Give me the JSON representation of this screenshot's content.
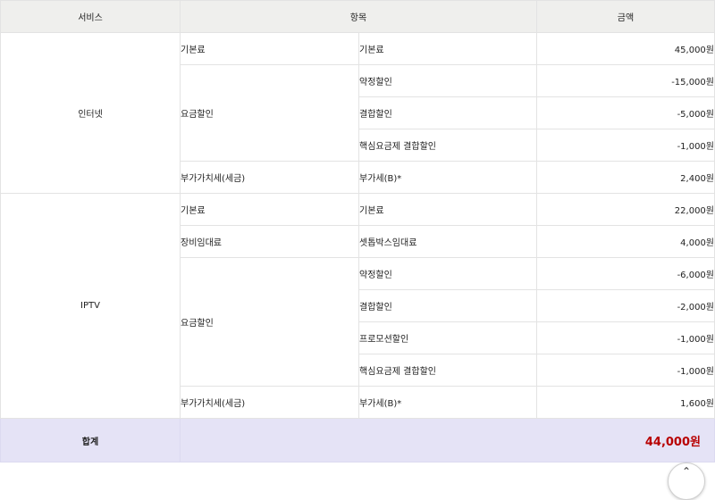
{
  "headers": {
    "service": "서비스",
    "item": "항목",
    "amount": "금액"
  },
  "internet": {
    "name": "인터넷",
    "basic": {
      "category": "기본료",
      "item": "기본료",
      "amount": "45,000원"
    },
    "discount": {
      "category": "요금할인",
      "rows": [
        {
          "item": "약정할인",
          "amount": "-15,000원"
        },
        {
          "item": "결합할인",
          "amount": "-5,000원"
        },
        {
          "item": "핵심요금제 결합할인",
          "amount": "-1,000원"
        }
      ]
    },
    "tax": {
      "category": "부가가치세(세금)",
      "item": "부가세(B)*",
      "amount": "2,400원"
    }
  },
  "iptv": {
    "name": "IPTV",
    "basic": {
      "category": "기본료",
      "item": "기본료",
      "amount": "22,000원"
    },
    "rental": {
      "category": "장비임대료",
      "item": "셋톱박스임대료",
      "amount": "4,000원"
    },
    "discount": {
      "category": "요금할인",
      "rows": [
        {
          "item": "약정할인",
          "amount": "-6,000원"
        },
        {
          "item": "결합할인",
          "amount": "-2,000원"
        },
        {
          "item": "프로모션할인",
          "amount": "-1,000원"
        },
        {
          "item": "핵심요금제 결합할인",
          "amount": "-1,000원"
        }
      ]
    },
    "tax": {
      "category": "부가가치세(세금)",
      "item": "부가세(B)*",
      "amount": "1,600원"
    }
  },
  "total": {
    "label": "합계",
    "amount": "44,000원"
  },
  "colors": {
    "header_bg": "#efefed",
    "total_bg": "#e5e3f6",
    "total_amount": "#b80000"
  },
  "scroll_top_icon": "chevron-up-icon"
}
